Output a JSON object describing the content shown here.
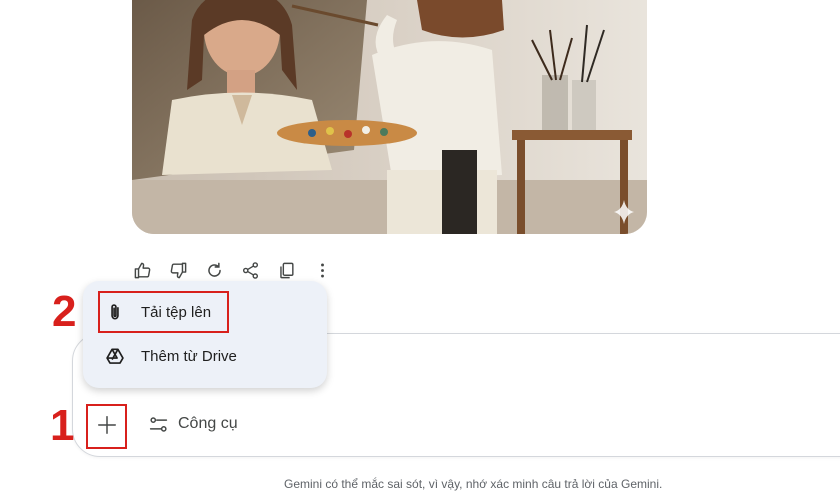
{
  "image": {
    "alt": "",
    "sparkle_icon": "sparkle-icon"
  },
  "response_actions": [
    {
      "name": "thumbs-up-icon"
    },
    {
      "name": "thumbs-down-icon"
    },
    {
      "name": "redo-icon"
    },
    {
      "name": "share-icon"
    },
    {
      "name": "copy-icon"
    },
    {
      "name": "more-vert-icon"
    }
  ],
  "attach_menu": {
    "items": [
      {
        "label": "Tải tệp lên",
        "icon": "paperclip-icon"
      },
      {
        "label": "Thêm từ Drive",
        "icon": "drive-icon"
      }
    ]
  },
  "input": {
    "add_button_icon": "plus-icon",
    "tools_label": "Công cụ",
    "tools_icon": "tune-icon"
  },
  "annotations": {
    "step1": "1",
    "step2": "2",
    "color": "#d8201c"
  },
  "footer": {
    "disclaimer": "Gemini có thể mắc sai sót, vì vậy, nhớ xác minh câu trả lời của Gemini."
  }
}
